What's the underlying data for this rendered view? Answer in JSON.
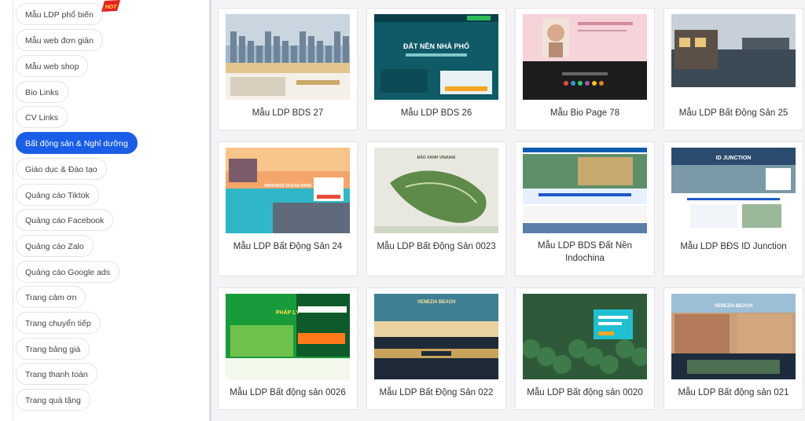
{
  "sidebar": {
    "categories": [
      {
        "label": "Mẫu LDP phổ biến",
        "hot": true
      },
      {
        "label": "Mẫu web đơn giản"
      },
      {
        "label": "Mẫu web shop"
      },
      {
        "label": "Bio Links"
      },
      {
        "label": "CV Links"
      },
      {
        "label": "Bất động sản & Nghỉ dưỡng",
        "active": true
      },
      {
        "label": "Giáo dục & Đào tạo"
      },
      {
        "label": "Quảng cáo Tiktok"
      },
      {
        "label": "Quảng cáo Facebook"
      },
      {
        "label": "Quảng cáo Zalo"
      },
      {
        "label": "Quảng cáo Google ads"
      },
      {
        "label": "Trang cảm ơn"
      },
      {
        "label": "Trang chuyển tiếp"
      },
      {
        "label": "Trang bảng giá"
      },
      {
        "label": "Trang thanh toán"
      },
      {
        "label": "Trang quà tặng"
      }
    ],
    "hot_badge": "HOT",
    "active_color": "#1a5ee8"
  },
  "templates": [
    {
      "title": "Mẫu LDP BDS 27",
      "thumb_heading": "",
      "scheme": "city"
    },
    {
      "title": "Mẫu LDP BDS 26",
      "thumb_heading": "ĐẤT NỀN NHÀ PHỐ",
      "scheme": "teal"
    },
    {
      "title": "Mẫu Bio Page 78",
      "thumb_heading": "",
      "scheme": "bio"
    },
    {
      "title": "Mẫu LDP Bất Động Sản 25",
      "thumb_heading": "",
      "scheme": "villa"
    },
    {
      "title": "Mẫu LDP Bất Động Sản 24",
      "thumb_heading": "VINHOMES OCEAN PARK",
      "scheme": "ocean"
    },
    {
      "title": "Mẫu LDP Bất Động Sản 0023",
      "thumb_heading": "ĐẢO XANH VINAHAI",
      "scheme": "island"
    },
    {
      "title": "Mẫu LDP BDS Đất Nền Indochina",
      "thumb_heading": "",
      "scheme": "aerial"
    },
    {
      "title": "Mẫu LDP BĐS ID Junction",
      "thumb_heading": "ID JUNCTION",
      "scheme": "junction"
    },
    {
      "title": "Mẫu LDP Bất động sản 0026",
      "thumb_heading": "PHÁP LÝ",
      "scheme": "green"
    },
    {
      "title": "Mẫu LDP Bất Động Sản 022",
      "thumb_heading": "VENEZIA BEACH",
      "scheme": "beach"
    },
    {
      "title": "Mẫu LDP Bất động sản 0020",
      "thumb_heading": "",
      "scheme": "forest"
    },
    {
      "title": "Mẫu LDP Bất động sản 021",
      "thumb_heading": "VENEZIA BEACH",
      "scheme": "venezia"
    }
  ]
}
